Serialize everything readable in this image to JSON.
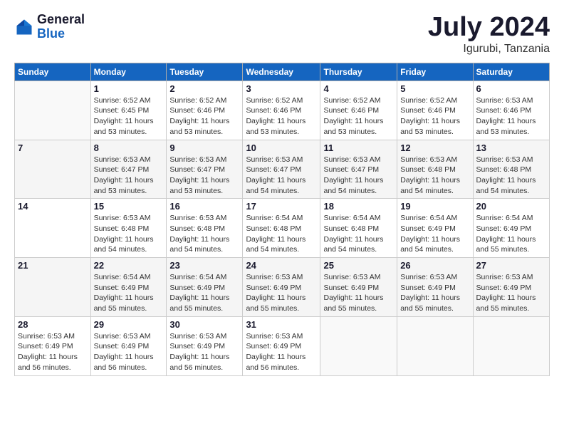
{
  "logo": {
    "general": "General",
    "blue": "Blue"
  },
  "header": {
    "month": "July 2024",
    "location": "Igurubi, Tanzania"
  },
  "weekdays": [
    "Sunday",
    "Monday",
    "Tuesday",
    "Wednesday",
    "Thursday",
    "Friday",
    "Saturday"
  ],
  "weeks": [
    [
      {
        "day": "",
        "info": ""
      },
      {
        "day": "1",
        "info": "Sunrise: 6:52 AM\nSunset: 6:45 PM\nDaylight: 11 hours\nand 53 minutes."
      },
      {
        "day": "2",
        "info": "Sunrise: 6:52 AM\nSunset: 6:46 PM\nDaylight: 11 hours\nand 53 minutes."
      },
      {
        "day": "3",
        "info": "Sunrise: 6:52 AM\nSunset: 6:46 PM\nDaylight: 11 hours\nand 53 minutes."
      },
      {
        "day": "4",
        "info": "Sunrise: 6:52 AM\nSunset: 6:46 PM\nDaylight: 11 hours\nand 53 minutes."
      },
      {
        "day": "5",
        "info": "Sunrise: 6:52 AM\nSunset: 6:46 PM\nDaylight: 11 hours\nand 53 minutes."
      },
      {
        "day": "6",
        "info": "Sunrise: 6:53 AM\nSunset: 6:46 PM\nDaylight: 11 hours\nand 53 minutes."
      }
    ],
    [
      {
        "day": "7",
        "info": ""
      },
      {
        "day": "8",
        "info": "Sunrise: 6:53 AM\nSunset: 6:47 PM\nDaylight: 11 hours\nand 53 minutes."
      },
      {
        "day": "9",
        "info": "Sunrise: 6:53 AM\nSunset: 6:47 PM\nDaylight: 11 hours\nand 53 minutes."
      },
      {
        "day": "10",
        "info": "Sunrise: 6:53 AM\nSunset: 6:47 PM\nDaylight: 11 hours\nand 54 minutes."
      },
      {
        "day": "11",
        "info": "Sunrise: 6:53 AM\nSunset: 6:47 PM\nDaylight: 11 hours\nand 54 minutes."
      },
      {
        "day": "12",
        "info": "Sunrise: 6:53 AM\nSunset: 6:48 PM\nDaylight: 11 hours\nand 54 minutes."
      },
      {
        "day": "13",
        "info": "Sunrise: 6:53 AM\nSunset: 6:48 PM\nDaylight: 11 hours\nand 54 minutes."
      }
    ],
    [
      {
        "day": "14",
        "info": ""
      },
      {
        "day": "15",
        "info": "Sunrise: 6:53 AM\nSunset: 6:48 PM\nDaylight: 11 hours\nand 54 minutes."
      },
      {
        "day": "16",
        "info": "Sunrise: 6:53 AM\nSunset: 6:48 PM\nDaylight: 11 hours\nand 54 minutes."
      },
      {
        "day": "17",
        "info": "Sunrise: 6:54 AM\nSunset: 6:48 PM\nDaylight: 11 hours\nand 54 minutes."
      },
      {
        "day": "18",
        "info": "Sunrise: 6:54 AM\nSunset: 6:48 PM\nDaylight: 11 hours\nand 54 minutes."
      },
      {
        "day": "19",
        "info": "Sunrise: 6:54 AM\nSunset: 6:49 PM\nDaylight: 11 hours\nand 54 minutes."
      },
      {
        "day": "20",
        "info": "Sunrise: 6:54 AM\nSunset: 6:49 PM\nDaylight: 11 hours\nand 55 minutes."
      }
    ],
    [
      {
        "day": "21",
        "info": ""
      },
      {
        "day": "22",
        "info": "Sunrise: 6:54 AM\nSunset: 6:49 PM\nDaylight: 11 hours\nand 55 minutes."
      },
      {
        "day": "23",
        "info": "Sunrise: 6:54 AM\nSunset: 6:49 PM\nDaylight: 11 hours\nand 55 minutes."
      },
      {
        "day": "24",
        "info": "Sunrise: 6:53 AM\nSunset: 6:49 PM\nDaylight: 11 hours\nand 55 minutes."
      },
      {
        "day": "25",
        "info": "Sunrise: 6:53 AM\nSunset: 6:49 PM\nDaylight: 11 hours\nand 55 minutes."
      },
      {
        "day": "26",
        "info": "Sunrise: 6:53 AM\nSunset: 6:49 PM\nDaylight: 11 hours\nand 55 minutes."
      },
      {
        "day": "27",
        "info": "Sunrise: 6:53 AM\nSunset: 6:49 PM\nDaylight: 11 hours\nand 55 minutes."
      }
    ],
    [
      {
        "day": "28",
        "info": "Sunrise: 6:53 AM\nSunset: 6:49 PM\nDaylight: 11 hours\nand 56 minutes."
      },
      {
        "day": "29",
        "info": "Sunrise: 6:53 AM\nSunset: 6:49 PM\nDaylight: 11 hours\nand 56 minutes."
      },
      {
        "day": "30",
        "info": "Sunrise: 6:53 AM\nSunset: 6:49 PM\nDaylight: 11 hours\nand 56 minutes."
      },
      {
        "day": "31",
        "info": "Sunrise: 6:53 AM\nSunset: 6:49 PM\nDaylight: 11 hours\nand 56 minutes."
      },
      {
        "day": "",
        "info": ""
      },
      {
        "day": "",
        "info": ""
      },
      {
        "day": "",
        "info": ""
      }
    ]
  ]
}
